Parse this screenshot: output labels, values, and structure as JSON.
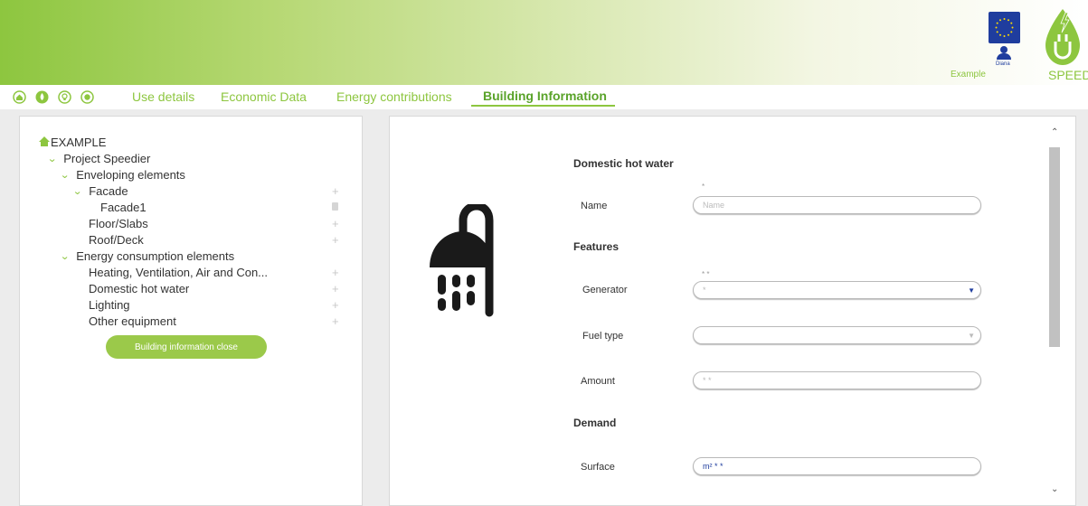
{
  "header": {
    "example_link": "Example",
    "user_name": "Diana",
    "logo_text": "SPEEDIER"
  },
  "nav": {
    "icons": [
      "home-icon",
      "leaf-icon",
      "lightbulb-icon",
      "target-icon"
    ],
    "tabs": [
      {
        "label": "Use details"
      },
      {
        "label": "Economic Data"
      },
      {
        "label": "Energy contributions"
      },
      {
        "label": "Building Information",
        "active": true
      }
    ]
  },
  "tree": {
    "root": "EXAMPLE",
    "project": "Project Speedier",
    "enveloping": "Enveloping elements",
    "facade": "Facade",
    "facade1": "Facade1",
    "floor": "Floor/Slabs",
    "roof": "Roof/Deck",
    "energy": "Energy consumption elements",
    "hvac": "Heating, Ventilation, Air and Con...",
    "dhw": "Domestic hot water",
    "lighting": "Lighting",
    "other": "Other equipment",
    "close_button": "Building information close"
  },
  "form": {
    "title": "Domestic hot water",
    "name_label": "Name",
    "name_marker": "*",
    "name_placeholder": "Name",
    "features_title": "Features",
    "generator_label": "Generator",
    "generator_marker": "* *",
    "generator_value": "*",
    "fuel_label": "Fuel type",
    "fuel_value": "",
    "amount_label": "Amount",
    "amount_value": "* *",
    "demand_title": "Demand",
    "surface_label": "Surface",
    "surface_value": "m² * *"
  },
  "colors": {
    "brand_green": "#8dc63f",
    "eu_blue": "#1f3d9e"
  }
}
